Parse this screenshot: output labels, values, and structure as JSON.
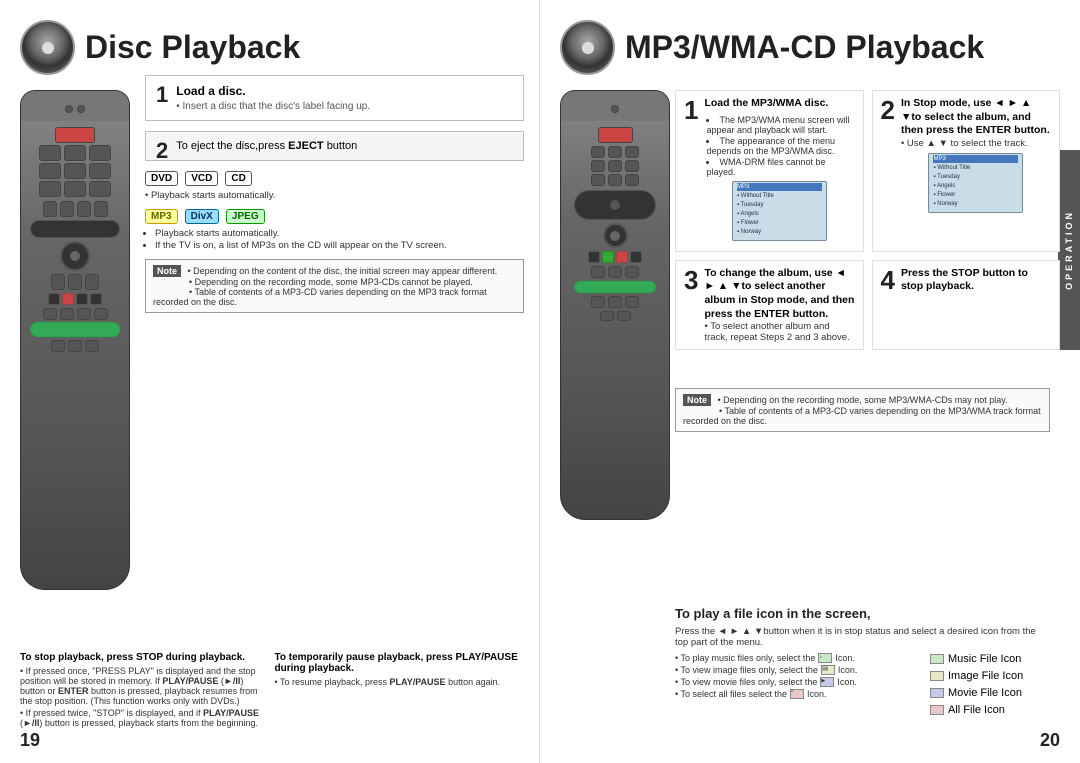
{
  "left": {
    "title": "Disc Playback",
    "page_num": "19",
    "step1": {
      "number": "1",
      "title": "Load a disc.",
      "sub": "• Insert a disc that the disc's label facing up."
    },
    "step2": {
      "number": "2",
      "text_pre": "To eject the disc,press",
      "text_bold": "EJECT",
      "text_post": "button"
    },
    "formats1": {
      "badges": [
        "DVD",
        "VCD",
        "CD"
      ],
      "bullet": "• Playback starts automatically."
    },
    "formats2": {
      "badges": [
        "MP3",
        "DivX",
        "JPEG"
      ],
      "bullets": [
        "• Playback starts automatically.",
        "• If the TV is on, a list of MP3s on the CD will appear on the TV screen."
      ]
    },
    "note": {
      "label": "Note",
      "items": [
        "• Depending on the content of the disc, the initial screen may appear different.",
        "• Depending on the recording mode, some MP3-CDs cannot be played.",
        "• Table of contents of a MP3-CD varies depending on the MP3 track format recorded on the disc."
      ]
    },
    "stop_section": {
      "title": "To stop playback, press STOP during playback.",
      "bullets": [
        "• If pressed once, 'PRESS PLAY' is displayed and the stop position will be stored in memory. If PLAY/PAUSE (►/II) button or ENTER button is pressed, playback resumes from the stop position. (This function works only with DVDs.)",
        "• If pressed twice, 'STOP' is displayed, and if PLAY/PAUSE (►/II) button is pressed, playback starts from the beginning."
      ]
    },
    "pause_section": {
      "title": "To temporarily pause playback, press PLAY/PAUSE during playback.",
      "bullets": [
        "• To resume playback, press PLAY/PAUSE button again."
      ]
    }
  },
  "right": {
    "title": "MP3/WMA-CD Playback",
    "page_num": "20",
    "step1": {
      "number": "1",
      "text": "Load the MP3/WMA disc."
    },
    "step2": {
      "number": "2",
      "text": "In Stop mode, use ◄ ► ▲ ▼to select the album, and then press the ENTER button."
    },
    "step3": {
      "number": "3",
      "text": "To change the album, use ◄ ► ▲ ▼to select another album in Stop mode, and then press the ENTER button."
    },
    "step4": {
      "number": "4",
      "text": "Press the STOP button to stop playback."
    },
    "step2_sub": "• Use ▲ ▼ to select the track.",
    "step3_sub": "• To select another album and track, repeat Steps 2 and 3 above.",
    "bullets_step1": [
      "• The MP3/WMA menu screen will appear and playback will start.",
      "• The appearance of the menu depends on the MP3/WMA disc.",
      "• WMA-DRM files cannot be played."
    ],
    "note": {
      "label": "Note",
      "items": [
        "• Depending on the recording mode, some MP3/WMA-CDs may not play.",
        "• Table of contents of a MP3-CD varies depending on the MP3/WMA track format recorded on the disc."
      ]
    },
    "file_section": {
      "title": "To play a file icon in the screen,",
      "sub": "Press the ◄ ► ▲ ▼button when it is in stop status and select a desired icon from the top part of the menu.",
      "bullets": [
        "• To play music files only, select the      Icon.",
        "• To view image files only, select the      Icon.",
        "• To view movie files only, select the      Icon.",
        "• To select all files select the      Icon."
      ],
      "legend": [
        {
          "label": "Music File Icon",
          "color": "legend-music"
        },
        {
          "label": "Image File Icon",
          "color": "legend-image"
        },
        {
          "label": "Movie File Icon",
          "color": "legend-movie"
        },
        {
          "label": "All File Icon",
          "color": "legend-all"
        }
      ]
    },
    "operation_label": "OPERATION"
  }
}
